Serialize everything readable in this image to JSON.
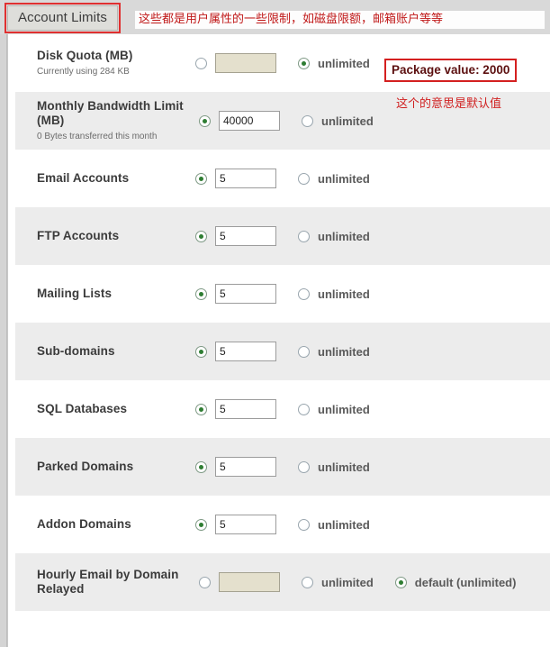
{
  "tab": {
    "label": "Account Limits"
  },
  "annotations": {
    "header_note": "这些都是用户属性的一些限制，如磁盘限额，邮箱账户等等",
    "package_value": "Package value: 2000",
    "default_note": "这个的意思是默认值"
  },
  "labels": {
    "unlimited": "unlimited",
    "default_unlimited": "default (unlimited)"
  },
  "rows": [
    {
      "label": "Disk Quota (MB)",
      "sub": "Currently using 284 KB",
      "value": "",
      "value_selected": false,
      "unlimited_selected": true,
      "input_disabled": true
    },
    {
      "label": "Monthly Bandwidth Limit (MB)",
      "sub": "0 Bytes transferred this month",
      "value": "40000",
      "value_selected": true,
      "unlimited_selected": false,
      "input_disabled": false
    },
    {
      "label": "Email Accounts",
      "sub": "",
      "value": "5",
      "value_selected": true,
      "unlimited_selected": false,
      "input_disabled": false
    },
    {
      "label": "FTP Accounts",
      "sub": "",
      "value": "5",
      "value_selected": true,
      "unlimited_selected": false,
      "input_disabled": false
    },
    {
      "label": "Mailing Lists",
      "sub": "",
      "value": "5",
      "value_selected": true,
      "unlimited_selected": false,
      "input_disabled": false
    },
    {
      "label": "Sub-domains",
      "sub": "",
      "value": "5",
      "value_selected": true,
      "unlimited_selected": false,
      "input_disabled": false
    },
    {
      "label": "SQL Databases",
      "sub": "",
      "value": "5",
      "value_selected": true,
      "unlimited_selected": false,
      "input_disabled": false
    },
    {
      "label": "Parked Domains",
      "sub": "",
      "value": "5",
      "value_selected": true,
      "unlimited_selected": false,
      "input_disabled": false
    },
    {
      "label": "Addon Domains",
      "sub": "",
      "value": "5",
      "value_selected": true,
      "unlimited_selected": false,
      "input_disabled": false
    },
    {
      "label": "Hourly Email by Domain Relayed",
      "sub": "",
      "value": "",
      "value_selected": false,
      "unlimited_selected": false,
      "default_selected": true,
      "input_disabled": true,
      "has_default": true
    }
  ],
  "colors": {
    "accent_red": "#d42020",
    "radio_on": "#2e7d32",
    "row_alt": "#ececec",
    "disabled_input": "#e4e0cd"
  }
}
